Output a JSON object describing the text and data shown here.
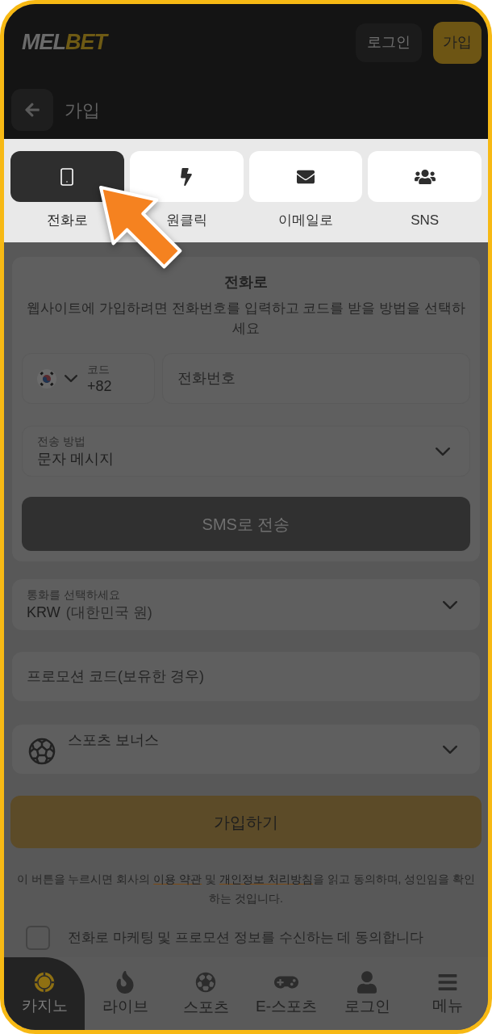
{
  "header": {
    "logo": {
      "parts": [
        "MEL",
        "BET"
      ]
    },
    "buttons": [
      {
        "label": "로그인",
        "kind": "secondary"
      },
      {
        "label": "가입",
        "kind": "primary"
      }
    ]
  },
  "subheader": {
    "title": "가입"
  },
  "tabs": [
    {
      "label": "전화로",
      "selected": true
    },
    {
      "label": "원클릭",
      "selected": false
    },
    {
      "label": "이메일로",
      "selected": false
    },
    {
      "label": "SNS",
      "selected": false
    }
  ],
  "form": {
    "title": "전화로",
    "description": "웹사이트에 가입하려면 전화번호를 입력하고 코드를 받을 방법을 선택하세요",
    "country_code": {
      "label": "코드",
      "value": "+82"
    },
    "phone": {
      "placeholder": "전화번호"
    },
    "method": {
      "label": "전송 방법",
      "value": "문자 메시지"
    },
    "send_button": {
      "label": "SMS로 전송",
      "disabled": true
    }
  },
  "currency": {
    "label": "통화를 선택하세요",
    "code": "KRW",
    "name": "(대한민국 원)"
  },
  "promo_code": {
    "placeholder": "프로모션 코드(보유한 경우)"
  },
  "bonus": {
    "value": "스포츠 보너스"
  },
  "register_button": {
    "label": "가입하기"
  },
  "terms": {
    "segments": [
      {
        "kind": "text",
        "text": "이 버튼을 누르시면 회사의 "
      },
      {
        "kind": "link",
        "text": "이용 약관"
      },
      {
        "kind": "text",
        "text": " 및 "
      },
      {
        "kind": "link",
        "text": "개인정보 처리방침"
      },
      {
        "kind": "text",
        "text": "을 읽고 동의하며, 성인임을 확인하는 것입니다."
      }
    ]
  },
  "marketing_consent": {
    "label": "전화로 마케팅 및 프로모션 정보를 수신하는 데 동의합니다",
    "checked": false
  },
  "bottom_nav": [
    {
      "label": "카지노",
      "selected": true
    },
    {
      "label": "라이브",
      "selected": false
    },
    {
      "label": "스포츠",
      "selected": false
    },
    {
      "label": "E-스포츠",
      "selected": false
    },
    {
      "label": "로그인",
      "selected": false
    },
    {
      "label": "메뉴",
      "selected": false
    }
  ]
}
